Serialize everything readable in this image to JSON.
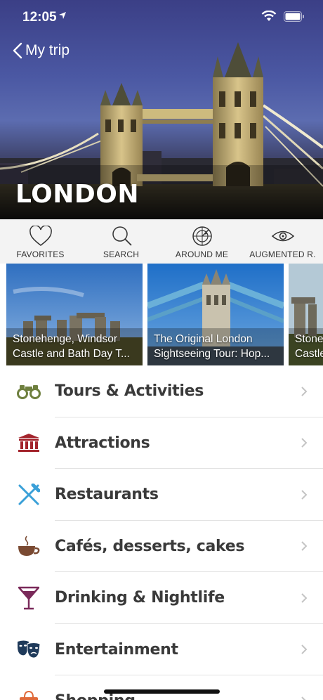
{
  "status": {
    "time": "12:05"
  },
  "nav": {
    "back_label": "My trip"
  },
  "hero": {
    "city": "LONDON"
  },
  "quicknav": [
    {
      "label": "FAVORITES",
      "icon": "heart-icon"
    },
    {
      "label": "SEARCH",
      "icon": "magnifier-icon"
    },
    {
      "label": "AROUND ME",
      "icon": "radar-icon"
    },
    {
      "label": "AUGMENTED R.",
      "icon": "eye-icon"
    }
  ],
  "cards": [
    {
      "line1": "Stonehenge, Windsor",
      "line2": "Castle and Bath Day T..."
    },
    {
      "line1": "The Original London",
      "line2": "Sightseeing Tour: Hop..."
    },
    {
      "line1": "Stone",
      "line2": "Castle"
    }
  ],
  "categories": [
    {
      "label": "Tours & Activities",
      "icon": "binoculars-icon",
      "color": "#7a8a4a"
    },
    {
      "label": "Attractions",
      "icon": "museum-icon",
      "color": "#a3242c"
    },
    {
      "label": "Restaurants",
      "icon": "fork-knife-icon",
      "color": "#3aa0d8"
    },
    {
      "label": "Cafés, desserts, cakes",
      "icon": "coffee-cup-icon",
      "color": "#7a4a32"
    },
    {
      "label": "Drinking & Nightlife",
      "icon": "cocktail-icon",
      "color": "#7a2a5a"
    },
    {
      "label": "Entertainment",
      "icon": "theater-masks-icon",
      "color": "#1f3a5a"
    },
    {
      "label": "Shopping",
      "icon": "shopping-bag-icon",
      "color": "#e06a3a"
    }
  ]
}
